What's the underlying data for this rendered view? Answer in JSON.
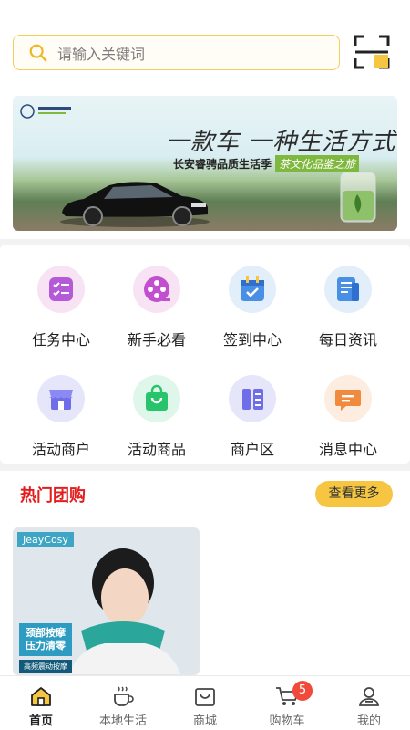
{
  "search": {
    "placeholder": "请输入关键词"
  },
  "banner": {
    "headline": "一款车 一种生活方式",
    "subline": "长安睿骋品质生活季",
    "tagline": "茶文化品鉴之旅"
  },
  "grid": {
    "items": [
      {
        "label": "任务中心",
        "icon": "task-list-icon"
      },
      {
        "label": "新手必看",
        "icon": "film-reel-icon"
      },
      {
        "label": "签到中心",
        "icon": "calendar-check-icon"
      },
      {
        "label": "每日资讯",
        "icon": "news-icon"
      },
      {
        "label": "活动商户",
        "icon": "shop-icon"
      },
      {
        "label": "活动商品",
        "icon": "shopping-bag-icon"
      },
      {
        "label": "商户区",
        "icon": "columns-icon"
      },
      {
        "label": "消息中心",
        "icon": "message-icon"
      }
    ]
  },
  "hot": {
    "title": "热门团购",
    "more_label": "查看更多",
    "products": [
      {
        "brand": "JeayCosy",
        "promo": "颈部按摩压力清零",
        "promo_sub": "高频震动按摩"
      }
    ]
  },
  "tabbar": {
    "items": [
      {
        "label": "首页",
        "icon": "home-icon",
        "active": true
      },
      {
        "label": "本地生活",
        "icon": "coffee-cup-icon"
      },
      {
        "label": "商城",
        "icon": "bag-icon"
      },
      {
        "label": "购物车",
        "icon": "cart-icon",
        "badge": "5"
      },
      {
        "label": "我的",
        "icon": "user-icon"
      }
    ]
  },
  "colors": {
    "accent": "#f6c643",
    "hot_title": "#e21d1d",
    "badge": "#f04a3a"
  }
}
